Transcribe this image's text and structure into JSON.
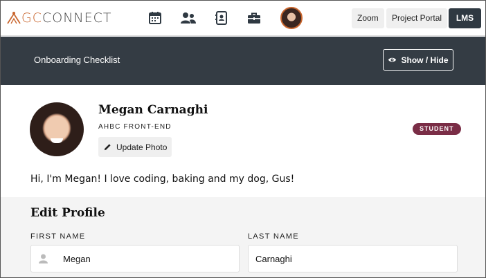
{
  "topnav": {
    "logo_gc": "GC",
    "logo_connect": "CONNECT",
    "icons": [
      "calendar-icon",
      "users-icon",
      "contacts-book-icon",
      "briefcase-icon"
    ],
    "buttons": {
      "zoom": "Zoom",
      "project_portal": "Project Portal",
      "lms": "LMS"
    }
  },
  "banner": {
    "title": "Onboarding Checklist",
    "toggle_label": "Show / Hide"
  },
  "profile": {
    "name": "Megan Carnaghi",
    "program": "AHBC FRONT-END",
    "update_photo_label": "Update Photo",
    "role_badge": "STUDENT",
    "bio": "Hi, I'm Megan! I love coding, baking and my dog, Gus!"
  },
  "edit_profile": {
    "title": "Edit Profile",
    "first_name_label": "FIRST NAME",
    "first_name_value": "Megan",
    "last_name_label": "LAST NAME",
    "last_name_value": "Carnaghi"
  },
  "colors": {
    "accent": "#c9662e",
    "banner_bg": "#343c44",
    "badge_bg": "#7a2d46",
    "lms_bg": "#2f3942"
  }
}
